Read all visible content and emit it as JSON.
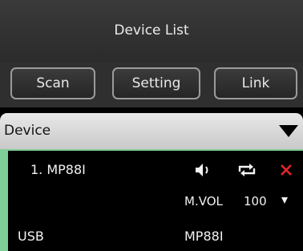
{
  "header": {
    "title": "Device List"
  },
  "toolbar": {
    "scan": "Scan",
    "setting": "Setting",
    "link": "Link"
  },
  "device_section": {
    "label": "Device"
  },
  "device": {
    "name": "1. MP88I",
    "vol_label": "M.VOL",
    "vol_value": "100",
    "connection": "USB",
    "model": "MP88I"
  },
  "icons": {
    "speaker": "speaker-icon",
    "repeat": "repeat-icon",
    "close": "close-icon",
    "close_color": "#e5262b",
    "accent_green": "#7fcf98"
  }
}
